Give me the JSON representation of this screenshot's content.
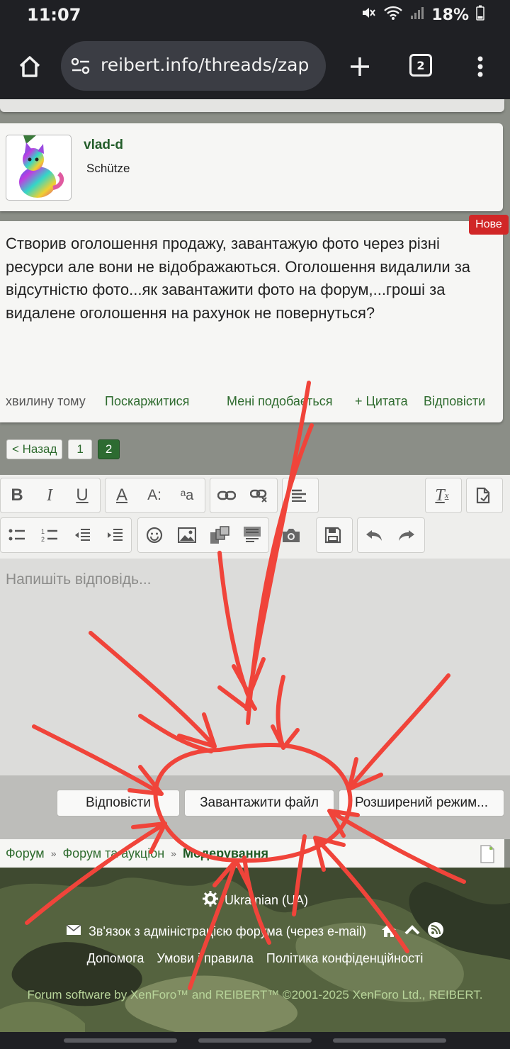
{
  "status_bar": {
    "time": "11:07",
    "battery": "18%"
  },
  "browser": {
    "url": "reibert.info/threads/zap",
    "tab_count": "2"
  },
  "post": {
    "username": "vlad-d",
    "user_title": "Schütze",
    "new_badge": "Нове",
    "text": "Створив оголошення продажу, завантажую фото через різні ресурси але вони не відображаються. Оголошення видалили за відсутністю фото...як завантажити фото на форум,...гроші за видалене оголошення на рахунок не повернуться?",
    "time": "хвилину тому",
    "report": "Поскаржитися",
    "like": "Мені подобається",
    "quote": "+ Цитата",
    "reply": "Відповісти"
  },
  "pagination": {
    "prev": "< Назад",
    "pages": [
      "1",
      "2"
    ],
    "current": "2"
  },
  "editor": {
    "placeholder": "Напишіть відповідь..."
  },
  "actions": {
    "reply": "Відповісти",
    "upload": "Завантажити файл",
    "advanced": "Розширений режим..."
  },
  "breadcrumb": [
    "Форум",
    "Форум та аукціон",
    "Модерування"
  ],
  "footer": {
    "language": "Ukrainian (UA)",
    "contact": "Зв'язок з адміністрацією форума (через e-mail)",
    "help": "Допомога",
    "terms": "Умови і правила",
    "privacy": "Політика конфіденційності",
    "copyright": "Forum software by XenForo™ and REIBERT™ ©2001-2025 XenForo Ltd., REIBERT."
  },
  "colors": {
    "accent": "#2d6b31",
    "badge": "#d12727",
    "annotation": "#f0443a"
  }
}
